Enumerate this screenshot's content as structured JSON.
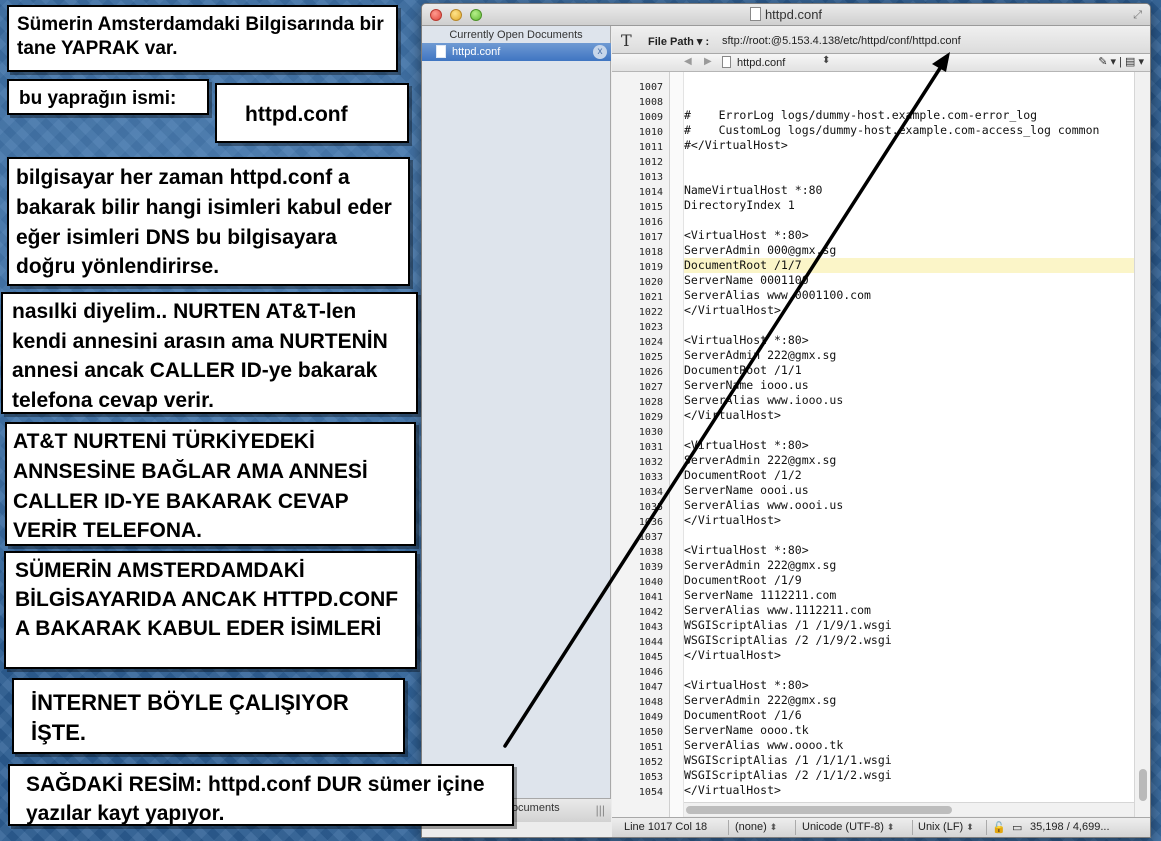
{
  "window": {
    "title": "httpd.conf",
    "sidebar": {
      "header": "Currently Open Documents",
      "items": [
        {
          "label": "httpd.conf"
        }
      ],
      "close_glyph": "x",
      "footer_label": "Documents"
    },
    "toolbar": {
      "text_tool_glyph": "T",
      "file_path_label": "File Path ▾ :",
      "file_path_value": "sftp://root:@5.153.4.138/etc/httpd/conf/httpd.conf"
    },
    "navbar": {
      "file": "httpd.conf",
      "right_controls": "✎ ▾ | ▤ ▾"
    },
    "editor": {
      "highlight_line": 1017,
      "lines": [
        {
          "n": "1007",
          "t": "#    ErrorLog logs/dummy-host.example.com-error_log"
        },
        {
          "n": "1008",
          "t": "#    CustomLog logs/dummy-host.example.com-access_log common"
        },
        {
          "n": "1009",
          "t": "#</VirtualHost>"
        },
        {
          "n": "1010",
          "t": ""
        },
        {
          "n": "1011",
          "t": ""
        },
        {
          "n": "1012",
          "t": "NameVirtualHost *:80"
        },
        {
          "n": "1013",
          "t": "DirectoryIndex 1"
        },
        {
          "n": "1014",
          "t": ""
        },
        {
          "n": "1015",
          "t": "<VirtualHost *:80>"
        },
        {
          "n": "1016",
          "t": "ServerAdmin 000@gmx.sg"
        },
        {
          "n": "1017",
          "t": "DocumentRoot /1/7"
        },
        {
          "n": "1018",
          "t": "ServerName 0001100"
        },
        {
          "n": "1019",
          "t": "ServerAlias www.0001100.com"
        },
        {
          "n": "1020",
          "t": "</VirtualHost>"
        },
        {
          "n": "1021",
          "t": ""
        },
        {
          "n": "1022",
          "t": "<VirtualHost *:80>"
        },
        {
          "n": "1023",
          "t": "ServerAdmin 222@gmx.sg"
        },
        {
          "n": "1024",
          "t": "DocumentRoot /1/1"
        },
        {
          "n": "1025",
          "t": "ServerName iooo.us"
        },
        {
          "n": "1026",
          "t": "ServerAlias www.iooo.us"
        },
        {
          "n": "1027",
          "t": "</VirtualHost>"
        },
        {
          "n": "1028",
          "t": ""
        },
        {
          "n": "1029",
          "t": "<VirtualHost *:80>"
        },
        {
          "n": "1030",
          "t": "ServerAdmin 222@gmx.sg"
        },
        {
          "n": "1031",
          "t": "DocumentRoot /1/2"
        },
        {
          "n": "1032",
          "t": "ServerName oooi.us"
        },
        {
          "n": "1033",
          "t": "ServerAlias www.oooi.us"
        },
        {
          "n": "1034",
          "t": "</VirtualHost>"
        },
        {
          "n": "1035",
          "t": ""
        },
        {
          "n": "1036",
          "t": "<VirtualHost *:80>"
        },
        {
          "n": "1037",
          "t": "ServerAdmin 222@gmx.sg"
        },
        {
          "n": "1038",
          "t": "DocumentRoot /1/9"
        },
        {
          "n": "1039",
          "t": "ServerName 1112211.com"
        },
        {
          "n": "1040",
          "t": "ServerAlias www.1112211.com"
        },
        {
          "n": "1041",
          "t": "WSGIScriptAlias /1 /1/9/1.wsgi"
        },
        {
          "n": "1042",
          "t": "WSGIScriptAlias /2 /1/9/2.wsgi"
        },
        {
          "n": "1043",
          "t": "</VirtualHost>"
        },
        {
          "n": "1044",
          "t": ""
        },
        {
          "n": "1045",
          "t": "<VirtualHost *:80>"
        },
        {
          "n": "1046",
          "t": "ServerAdmin 222@gmx.sg"
        },
        {
          "n": "1047",
          "t": "DocumentRoot /1/6"
        },
        {
          "n": "1048",
          "t": "ServerName oooo.tk"
        },
        {
          "n": "1049",
          "t": "ServerAlias www.oooo.tk"
        },
        {
          "n": "1050",
          "t": "WSGIScriptAlias /1 /1/1/1.wsgi"
        },
        {
          "n": "1051",
          "t": "WSGIScriptAlias /2 /1/1/2.wsgi"
        },
        {
          "n": "1052",
          "t": "</VirtualHost>"
        },
        {
          "n": "1053",
          "t": ""
        },
        {
          "n": "1054",
          "t": ""
        }
      ]
    },
    "status": {
      "position": "Line 1017 Col 18",
      "mode": "(none)",
      "encoding": "Unicode (UTF-8)",
      "line_endings": "Unix (LF)",
      "size": "35,198 / 4,699..."
    }
  },
  "annotations": {
    "box1": "Sümerin Amsterdamdaki Bilgisarında bir tane YAPRAK var.",
    "box2": "bu yaprağın ismi:",
    "box3": "httpd.conf",
    "box4": "bilgisayar her zaman httpd.conf a bakarak bilir hangi isimleri kabul eder eğer isimleri DNS bu bilgisayara doğru yönlendirirse.",
    "box5": "nasılki diyelim.. NURTEN AT&T-len kendi annesini arasın ama NURTENİN annesi ancak CALLER ID-ye bakarak telefona cevap verir.",
    "box6": "AT&T NURTENİ TÜRKİYEDEKİ ANNSESİNE BAĞLAR AMA ANNESİ CALLER ID-YE BAKARAK CEVAP VERİR TELEFONA.",
    "box7": "SÜMERİN AMSTERDAMDAKİ BİLGİSAYARIDA ANCAK HTTPD.CONF A BAKARAK KABUL EDER İSİMLERİ",
    "box8": "İNTERNET BÖYLE ÇALIŞIYOR İŞTE.",
    "box9": "SAĞDAKİ RESİM:  httpd.conf  DUR sümer içine yazılar kayt yapıyor."
  }
}
